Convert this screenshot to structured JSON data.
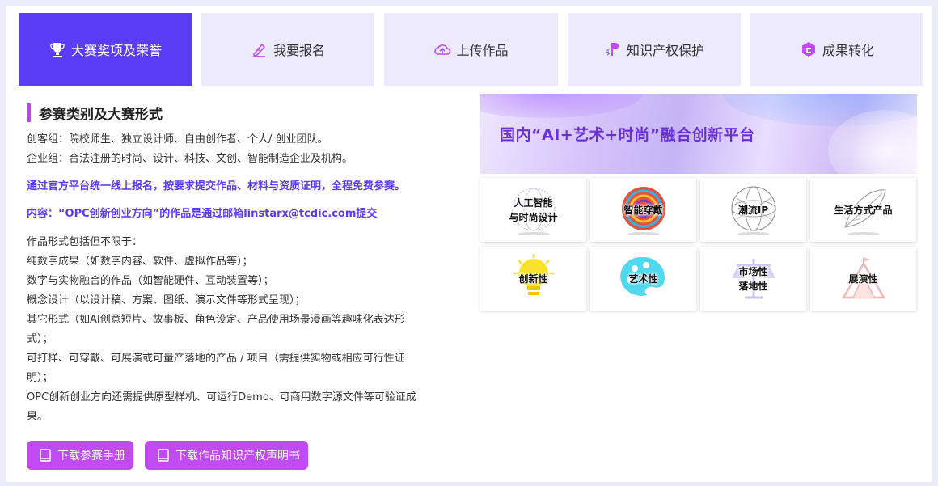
{
  "tabs": [
    {
      "label": "大赛奖项及荣誉",
      "icon": "trophy-icon",
      "active": true
    },
    {
      "label": "我要报名",
      "icon": "pen-edit-icon",
      "active": false
    },
    {
      "label": "上传作品",
      "icon": "cloud-upload-icon",
      "active": false
    },
    {
      "label": "知识产权保护",
      "icon": "ip-protection-icon",
      "active": false
    },
    {
      "label": "成果转化",
      "icon": "cube-transform-icon",
      "active": false
    }
  ],
  "section": {
    "title": "参赛类别及大赛形式",
    "groups": [
      "创客组：院校师生、独立设计师、自由创作者、个人/ 创业团队。",
      "企业组：合法注册的时尚、设计、科技、文创、智能制造企业及机构。"
    ],
    "highlight1": "通过官方平台统一线上报名，按要求提交作品、材料与资质证明，全程免费参赛。",
    "highlight2": "内容：“OPC创新创业方向”的作品是通过邮箱linstarx@tcdic.com提交",
    "forms": [
      "作品形式包括但不限于：",
      "纯数字成果（如数字内容、软件、虚拟作品等）；",
      "数字与实物融合的作品（如智能硬件、互动装置等）；",
      "概念设计（以设计稿、方案、图纸、演示文件等形式呈现）；",
      "其它形式（如AI创意短片、故事板、角色设定、产品使用场景漫画等趣味化表达形",
      "式）；",
      "可打样、可穿戴、可展演或可量产落地的产品 / 项目（需提供实物或相应可行性证",
      "明）；",
      "OPC创新创业方向还需提供原型样机、可运行Demo、可商用数字源文件等可验证成",
      "果。"
    ]
  },
  "buttons": {
    "handbook": "下载参赛手册",
    "ip_statement": "下载作品知识产权声明书"
  },
  "banner": {
    "text": "国内“AI+艺术+时尚”融合创新平台"
  },
  "categories": [
    {
      "label": "人工智能\n与时尚设计",
      "icon": "ai-globe-icon"
    },
    {
      "label": "智能穿戴",
      "icon": "colorful-wires-icon"
    },
    {
      "label": "潮流IP",
      "icon": "wireframe-sphere-icon"
    },
    {
      "label": "生活方式产品",
      "icon": "feather-icon"
    },
    {
      "label": "创新性",
      "icon": "lightbulb-icon"
    },
    {
      "label": "艺术性",
      "icon": "palette-icon"
    },
    {
      "label": "市场性\n落地性",
      "icon": "scale-icon"
    },
    {
      "label": "展演性",
      "icon": "tent-icon"
    }
  ],
  "colors": {
    "primary": "#5a3cf4",
    "accent": "#c04bf0",
    "tab_bg": "#edeafd"
  }
}
